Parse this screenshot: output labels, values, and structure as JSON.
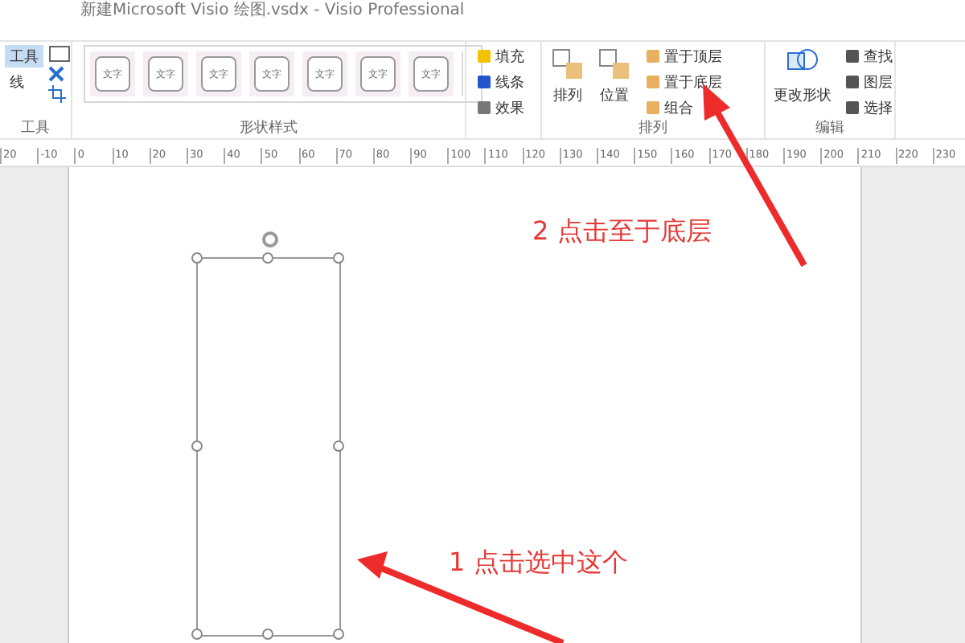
{
  "window": {
    "title": "新建Microsoft Visio 绘图.vsdx - Visio Professional"
  },
  "ribbon": {
    "tools_group": {
      "items": [
        {
          "label": "工具",
          "selected": true
        },
        {
          "label": "线",
          "selected": false
        }
      ],
      "label": "工具"
    },
    "shape_styles": {
      "thumbnails": [
        {
          "text": "文字"
        },
        {
          "text": "文字"
        },
        {
          "text": "文字"
        },
        {
          "text": "文字"
        },
        {
          "text": "文字"
        },
        {
          "text": "文字"
        },
        {
          "text": "文字"
        }
      ],
      "label": "形状样式"
    },
    "format_buttons": [
      {
        "label": "填充"
      },
      {
        "label": "线条"
      },
      {
        "label": "效果"
      }
    ],
    "arrange": {
      "large_buttons": [
        {
          "label": "排列"
        },
        {
          "label": "位置"
        }
      ],
      "small_buttons": [
        {
          "label": "置于顶层"
        },
        {
          "label": "置于底层"
        },
        {
          "label": "组合"
        }
      ],
      "label": "排列"
    },
    "editing": {
      "large_button": "更改形状",
      "small_buttons": [
        {
          "label": "查找"
        },
        {
          "label": "图层"
        },
        {
          "label": "选择"
        }
      ],
      "label": "编辑"
    }
  },
  "ruler": {
    "ticks": [
      "20",
      "-10",
      "0",
      "10",
      "20",
      "30",
      "40",
      "50",
      "60",
      "70",
      "80",
      "90",
      "100",
      "110",
      "120",
      "130",
      "140",
      "150",
      "160",
      "170",
      "180",
      "190",
      "200",
      "210",
      "220",
      "230"
    ]
  },
  "annotations": [
    {
      "text": "2 点击至于底层"
    },
    {
      "text": "1 点击选中这个"
    }
  ]
}
